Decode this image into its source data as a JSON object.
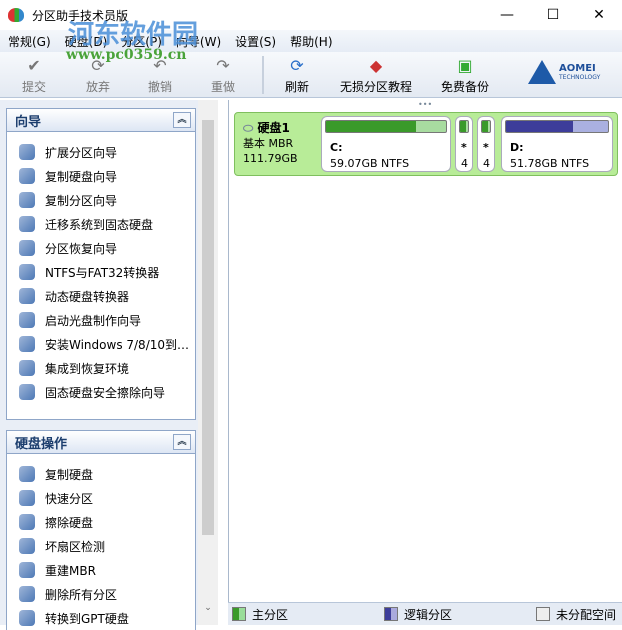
{
  "window": {
    "title": "分区助手技术员版",
    "watermark": "河东软件园",
    "watermark_url": "www.pc0359.cn",
    "min": "—",
    "max": "☐",
    "close": "✕"
  },
  "menu": [
    "常规(G)",
    "硬盘(D)",
    "分区(P)",
    "向导(W)",
    "设置(S)",
    "帮助(H)"
  ],
  "toolbar": {
    "commit": "提交",
    "discard": "放弃",
    "undo": "撤销",
    "redo": "重做",
    "refresh": "刷新",
    "tutorial": "无损分区教程",
    "backup": "免费备份",
    "logo": "AOMEI",
    "logo_sub": "TECHNOLOGY"
  },
  "wizard": {
    "title": "向导",
    "items": [
      "扩展分区向导",
      "复制硬盘向导",
      "复制分区向导",
      "迁移系统到固态硬盘",
      "分区恢复向导",
      "NTFS与FAT32转换器",
      "动态硬盘转换器",
      "启动光盘制作向导",
      "安装Windows 7/8/10到…",
      "集成到恢复环境",
      "固态硬盘安全擦除向导"
    ]
  },
  "disk_ops": {
    "title": "硬盘操作",
    "items": [
      "复制硬盘",
      "快速分区",
      "擦除硬盘",
      "坏扇区检测",
      "重建MBR",
      "删除所有分区",
      "转换到GPT硬盘"
    ]
  },
  "disk": {
    "name": "硬盘1",
    "type": "基本 MBR",
    "size": "111.79GB",
    "partitions": [
      {
        "label": "C:",
        "size": "59.07GB NTFS",
        "used": 0.75,
        "color": "#3a9a2a"
      },
      {
        "label": "*",
        "size": "4",
        "used": 0.7,
        "color": "#3a9a2a"
      },
      {
        "label": "*",
        "size": "4",
        "used": 0.7,
        "color": "#3a9a2a"
      },
      {
        "label": "D:",
        "size": "51.78GB NTFS",
        "used": 0.66,
        "color": "#3d3d9a"
      }
    ]
  },
  "legend": {
    "primary": "主分区",
    "logical": "逻辑分区",
    "unallocated": "未分配空间"
  }
}
